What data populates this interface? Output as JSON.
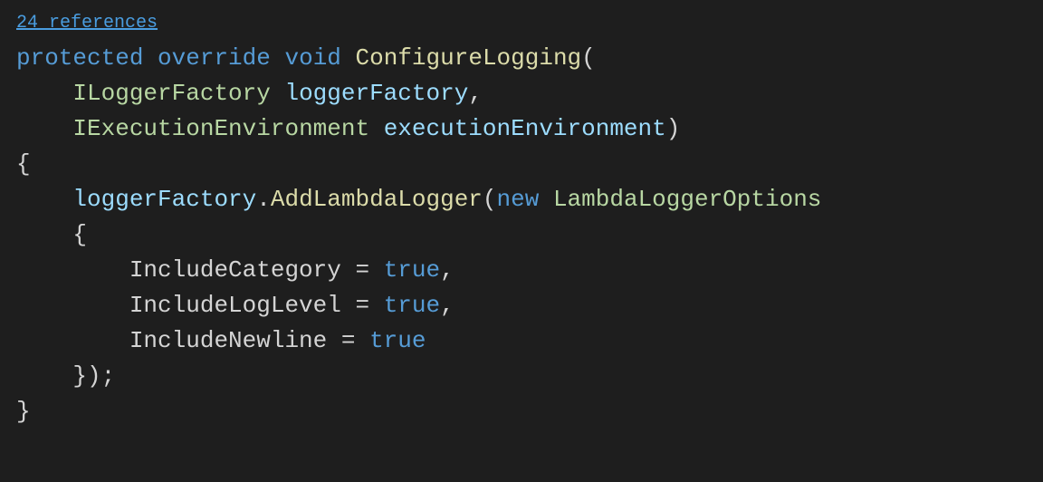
{
  "codelens": {
    "references": "24 references"
  },
  "code": {
    "line1": {
      "protected": "protected",
      "override": "override",
      "void": "void",
      "method": "ConfigureLogging",
      "paren_open": "("
    },
    "line2": {
      "type": "ILoggerFactory",
      "param": "loggerFactory",
      "comma": ","
    },
    "line3": {
      "type": "IExecutionEnvironment",
      "param": "executionEnvironment",
      "paren_close": ")"
    },
    "line4": {
      "brace": "{"
    },
    "line5": {
      "param": "loggerFactory",
      "dot": ".",
      "method": "AddLambdaLogger",
      "paren_open": "(",
      "new": "new",
      "type": "LambdaLoggerOptions"
    },
    "line6": {
      "brace": "{"
    },
    "line7": {
      "prop": "IncludeCategory",
      "equals": " = ",
      "value": "true",
      "comma": ","
    },
    "line8": {
      "prop": "IncludeLogLevel",
      "equals": " = ",
      "value": "true",
      "comma": ","
    },
    "line9": {
      "prop": "IncludeNewline",
      "equals": " = ",
      "value": "true"
    },
    "line10": {
      "close": "});"
    },
    "line11": {
      "brace": "}"
    }
  }
}
